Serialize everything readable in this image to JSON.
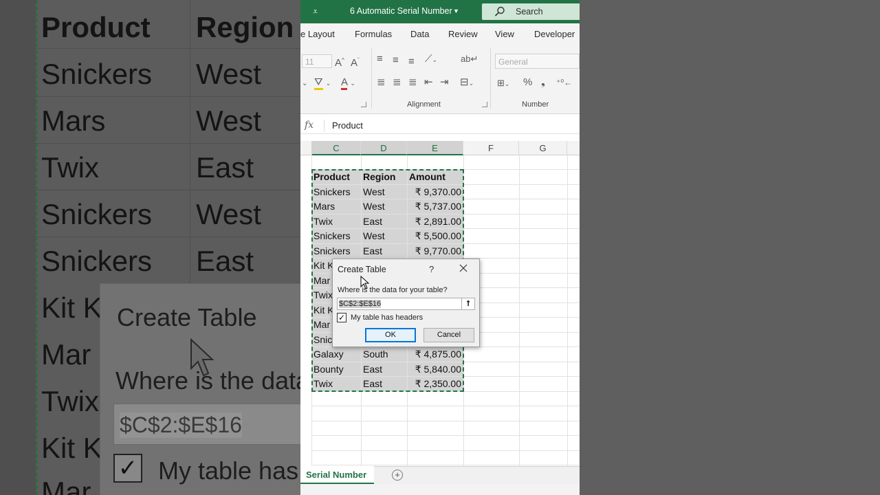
{
  "background": {
    "headers": [
      "Product",
      "Region"
    ],
    "rows": [
      [
        "Snickers",
        "West"
      ],
      [
        "Mars",
        "West"
      ],
      [
        "Twix",
        "East"
      ],
      [
        "Snickers",
        "West"
      ],
      [
        "Snickers",
        "East"
      ],
      [
        "Kit K",
        ""
      ],
      [
        "Mar",
        ""
      ],
      [
        "Twix",
        ""
      ],
      [
        "Kit K",
        ""
      ],
      [
        "Mar",
        ""
      ]
    ],
    "dialog_title": "Create Table",
    "dialog_prompt": "Where is the data f",
    "dialog_range": "$C$2:$E$16",
    "dialog_check_label": "My table has h"
  },
  "titlebar": {
    "doc_title": "6 Automatic Serial Number",
    "search_placeholder": "Search"
  },
  "ribbon_tabs": [
    "e Layout",
    "Formulas",
    "Data",
    "Review",
    "View",
    "Developer"
  ],
  "ribbon": {
    "font_size": "11",
    "number_format": "General",
    "group_alignment": "Alignment",
    "group_number": "Number"
  },
  "formula_bar": {
    "fx": "fx",
    "value": "Product"
  },
  "columns": [
    "C",
    "D",
    "E",
    "F",
    "G"
  ],
  "table": {
    "headers": [
      "Product",
      "Region",
      "Amount"
    ],
    "rows": [
      [
        "Snickers",
        "West",
        "₹ 9,370.00"
      ],
      [
        "Mars",
        "West",
        "₹ 5,737.00"
      ],
      [
        "Twix",
        "East",
        "₹ 2,891.00"
      ],
      [
        "Snickers",
        "West",
        "₹ 5,500.00"
      ],
      [
        "Snickers",
        "East",
        "₹ 9,770.00"
      ],
      [
        "Kit K",
        "",
        ""
      ],
      [
        "Mar",
        "",
        ""
      ],
      [
        "Twix",
        "",
        ""
      ],
      [
        "Kit K",
        "",
        ""
      ],
      [
        "Mar",
        "",
        ""
      ],
      [
        "Snic",
        "",
        ""
      ],
      [
        "Galaxy",
        "South",
        "₹ 4,875.00"
      ],
      [
        "Bounty",
        "East",
        "₹ 5,840.00"
      ],
      [
        "Twix",
        "East",
        "₹ 2,350.00"
      ]
    ]
  },
  "sheet_tabs": {
    "active": "Serial Number",
    "add": "+"
  },
  "dialog": {
    "title": "Create Table",
    "help": "?",
    "prompt": "Where is the data for your table?",
    "range": "$C$2:$E$16",
    "collapse": "⭡",
    "has_headers_checked": true,
    "check_mark": "✓",
    "has_headers_label": "My table has headers",
    "ok": "OK",
    "cancel": "Cancel"
  },
  "colors": {
    "excel_green": "#217346",
    "selection_gray": "#d4d4d4",
    "ok_border": "#0078d7"
  }
}
